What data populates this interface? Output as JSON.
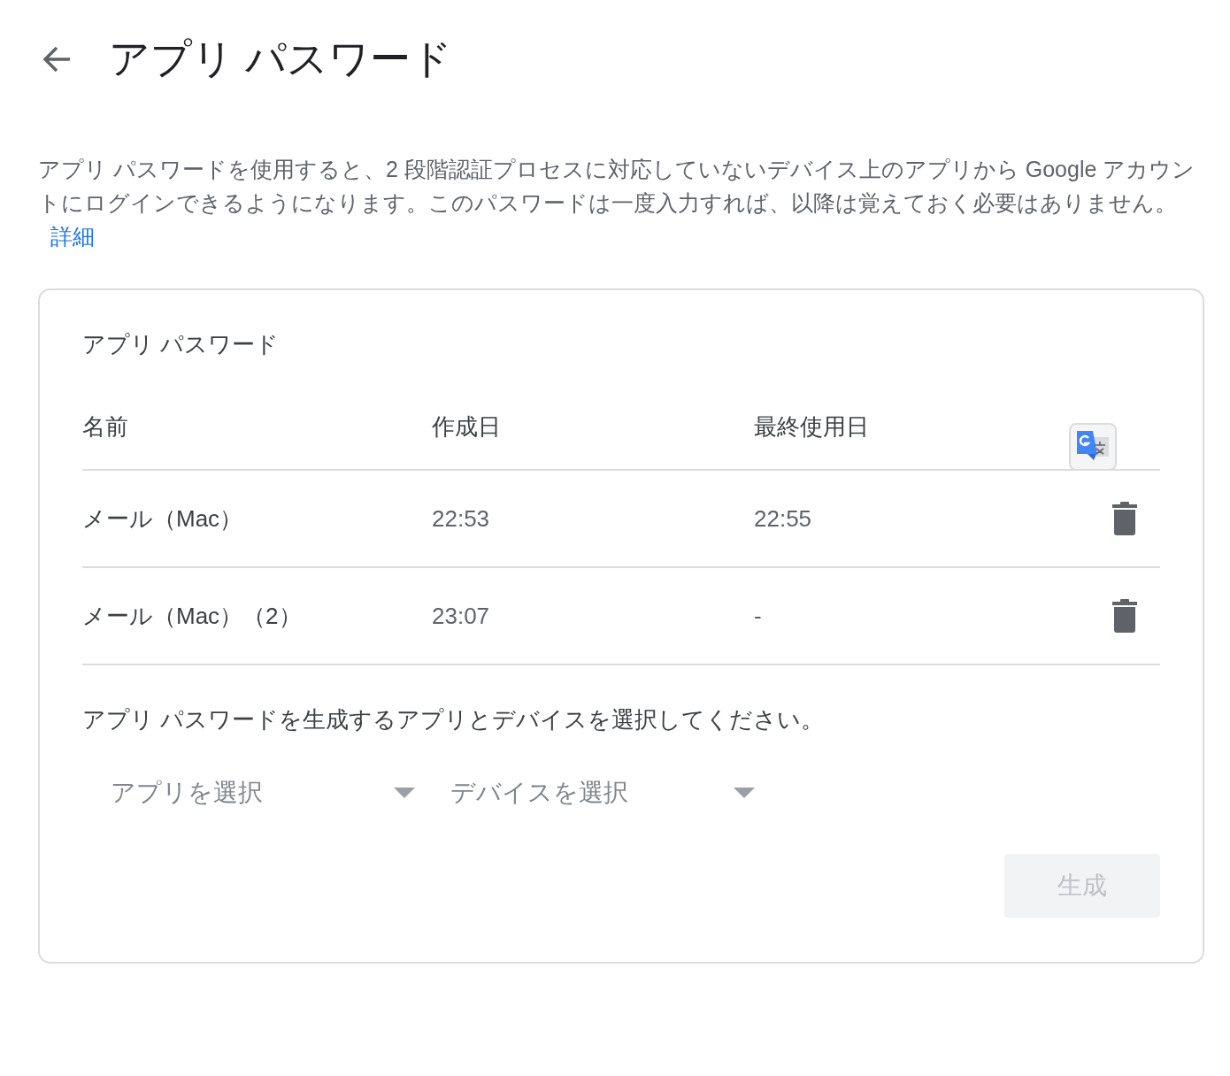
{
  "header": {
    "title": "アプリ パスワード"
  },
  "description": {
    "text": "アプリ パスワードを使用すると、2 段階認証プロセスに対応していないデバイス上のアプリから Google アカウントにログインできるようになります。このパスワードは一度入力すれば、以降は覚えておく必要はありません。",
    "link": "詳細"
  },
  "card": {
    "title": "アプリ パスワード",
    "columns": [
      "名前",
      "作成日",
      "最終使用日"
    ],
    "rows": [
      {
        "name": "メール（Mac）",
        "created": "22:53",
        "last_used": "22:55"
      },
      {
        "name": "メール（Mac）（2）",
        "created": "23:07",
        "last_used": "-"
      }
    ],
    "instruction": "アプリ パスワードを生成するアプリとデバイスを選択してください。",
    "selects": [
      {
        "placeholder": "アプリを選択"
      },
      {
        "placeholder": "デバイスを選択"
      }
    ],
    "generate_button": {
      "label": "生成",
      "disabled": true
    }
  }
}
